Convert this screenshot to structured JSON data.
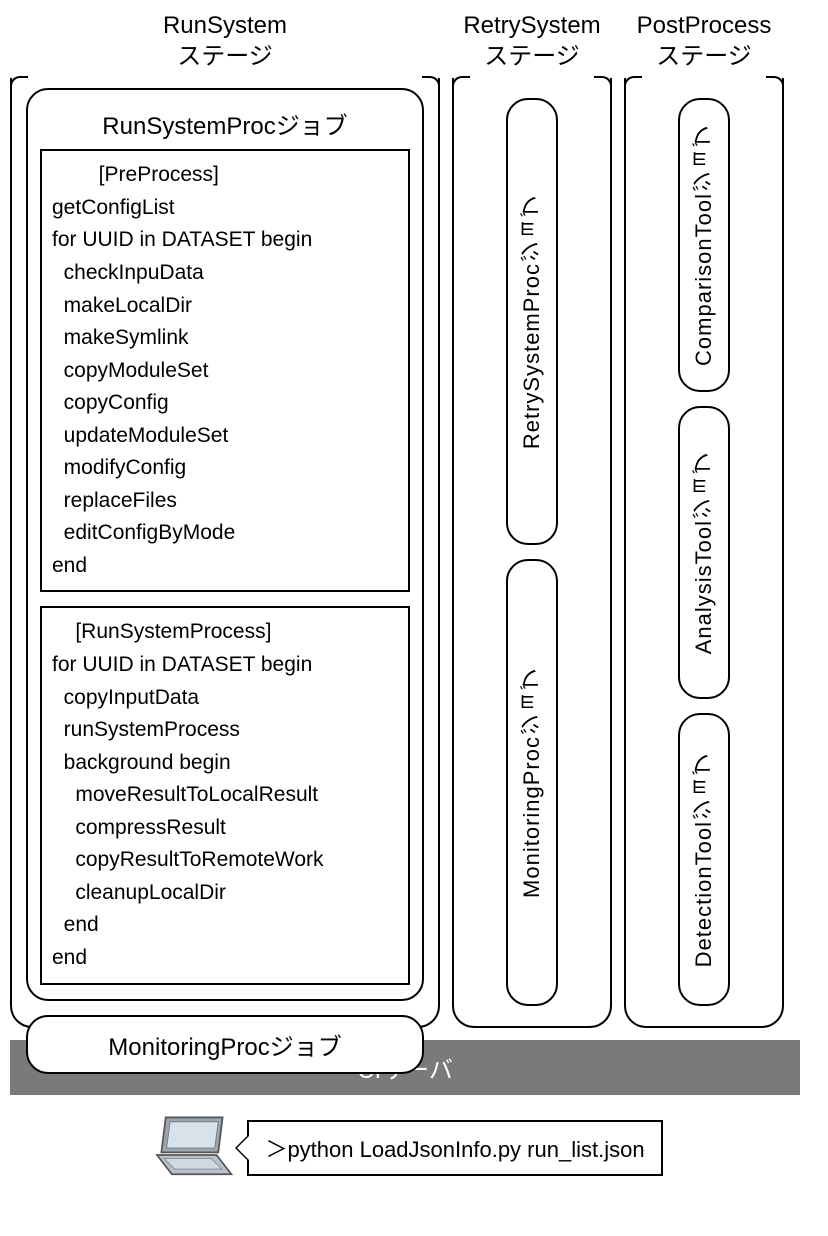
{
  "stages": {
    "run": {
      "title_line1": "RunSystem",
      "title_line2": "ステージ",
      "main_job_title": "RunSystemProcジョブ",
      "preprocess_block": "        [PreProcess]\ngetConfigList\nfor UUID in DATASET begin\n  checkInpuData\n  makeLocalDir\n  makeSymlink\n  copyModuleSet\n  copyConfig\n  updateModuleSet\n  modifyConfig\n  replaceFiles\n  editConfigByMode\nend",
      "runprocess_block": "    [RunSystemProcess]\nfor UUID in DATASET begin\n  copyInputData\n  runSystemProcess\n  background begin\n    moveResultToLocalResult\n    compressResult\n    copyResultToRemoteWork\n    cleanupLocalDir\n  end\nend",
      "monitor_job_title": "MonitoringProcジョブ"
    },
    "retry": {
      "title_line1": "RetrySystem",
      "title_line2": "ステージ",
      "job1": "RetrySystemProcジョブ",
      "job2": "MonitoringProcジョブ"
    },
    "post": {
      "title_line1": "PostProcess",
      "title_line2": "ステージ",
      "job1": "ComparisonToolジョブ",
      "job2": "AnalysisToolジョブ",
      "job3": "DetectionToolジョブ"
    }
  },
  "ci_server_label": "CIサーバ",
  "command_text": "＞python LoadJsonInfo.py run_list.json"
}
